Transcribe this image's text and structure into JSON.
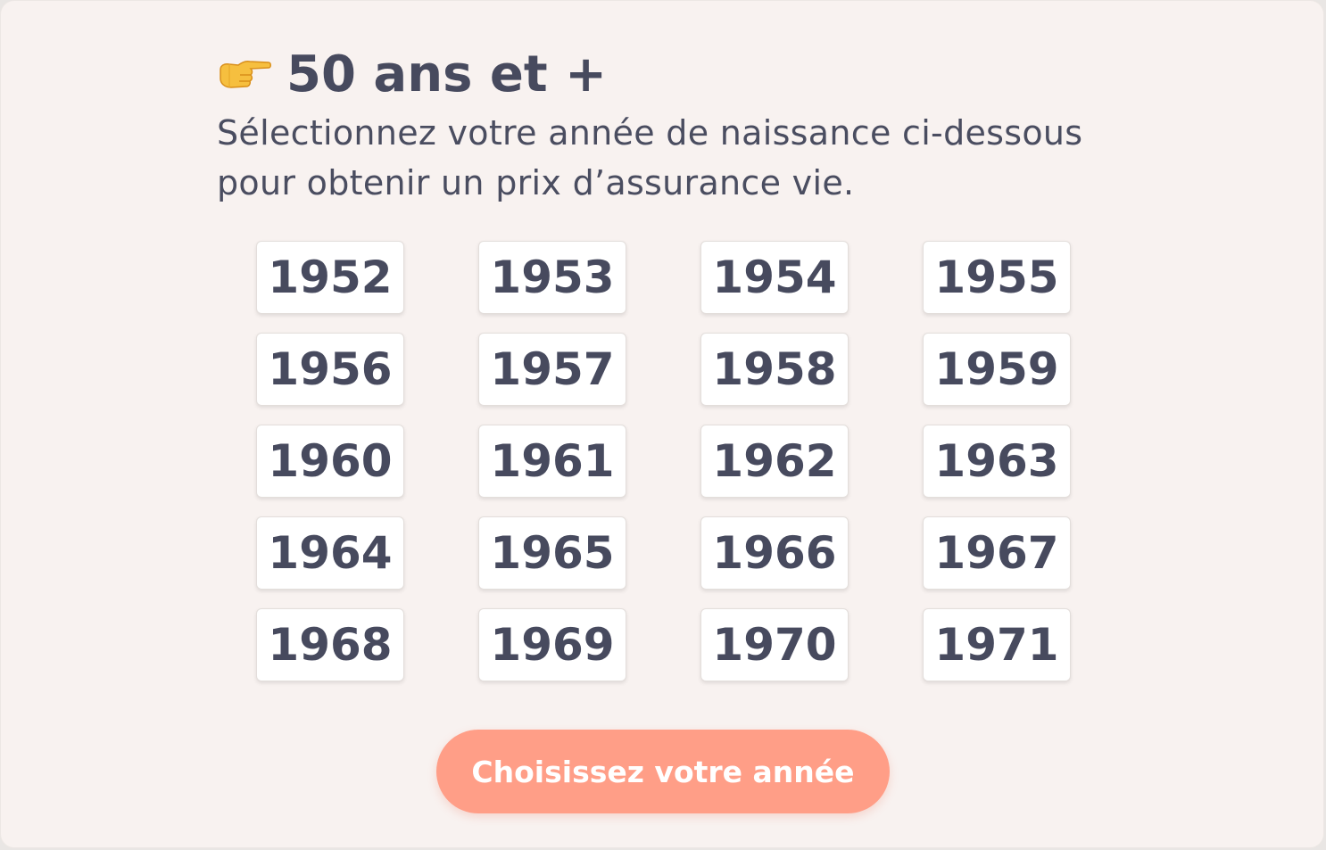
{
  "header": {
    "icon": "pointing-right-hand-icon",
    "title": "50 ans et +",
    "subtitle": "Sélectionnez votre année de naissance ci-dessous pour obtenir un prix d’assurance vie."
  },
  "years": [
    "1952",
    "1953",
    "1954",
    "1955",
    "1956",
    "1957",
    "1958",
    "1959",
    "1960",
    "1961",
    "1962",
    "1963",
    "1964",
    "1965",
    "1966",
    "1967",
    "1968",
    "1969",
    "1970",
    "1971"
  ],
  "cta": {
    "label": "Choisissez votre année"
  },
  "colors": {
    "background": "#f8f2f0",
    "text": "#474a5e",
    "button": "#ffffff",
    "cta": "#ff9e87"
  }
}
